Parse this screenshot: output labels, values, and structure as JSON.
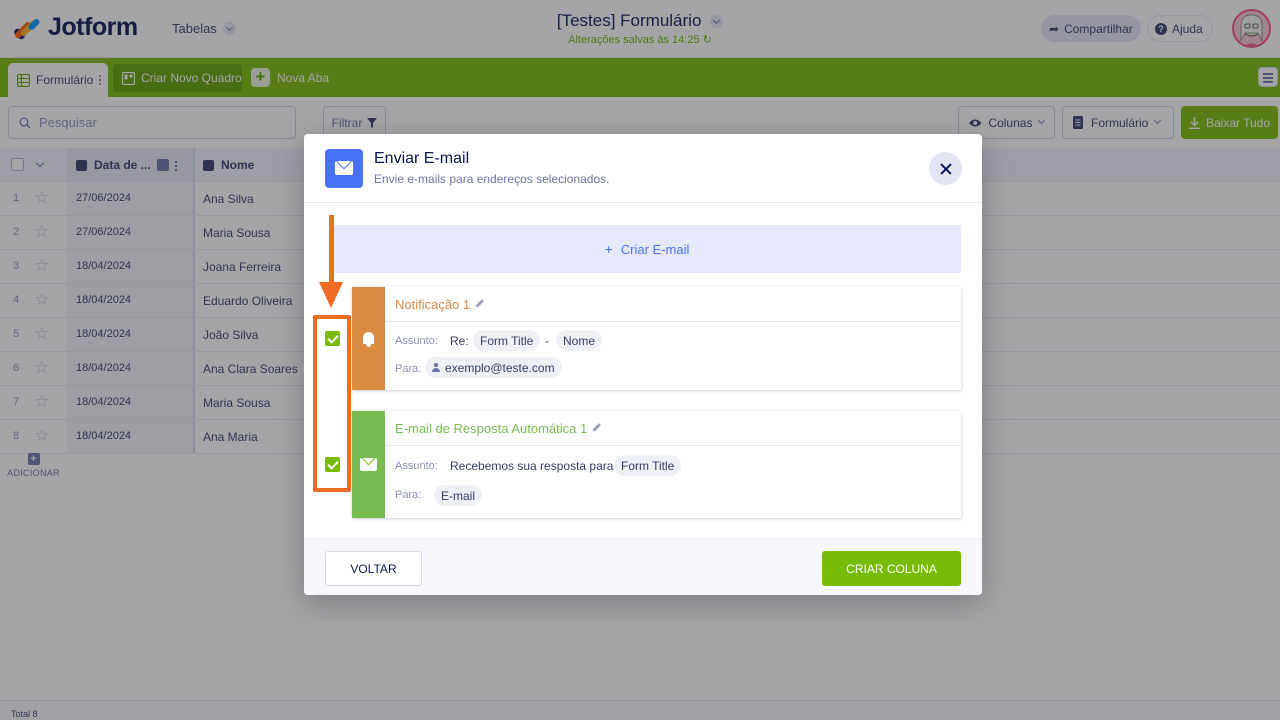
{
  "header": {
    "logo_text": "Jotform",
    "tables_menu": "Tabelas",
    "doc_title": "[Testes] Formulário",
    "status": "Alterações salvas às 14:25",
    "share": "Compartilhar",
    "help": "Ajuda"
  },
  "tabs": {
    "active": "Formulário",
    "board": "Criar Novo Quadro",
    "new_tab": "Nova Aba"
  },
  "toolbar": {
    "search_placeholder": "Pesquisar",
    "filter": "Filtrar",
    "columns": "Colunas",
    "form": "Formulário",
    "download": "Baixar Tudo"
  },
  "table": {
    "columns": [
      "Data de ...",
      "Nome"
    ],
    "rows": [
      {
        "num": "1",
        "date": "27/06/2024",
        "name": "Ana Silva"
      },
      {
        "num": "2",
        "date": "27/06/2024",
        "name": "Maria Sousa"
      },
      {
        "num": "3",
        "date": "18/04/2024",
        "name": "Joana Ferreira"
      },
      {
        "num": "4",
        "date": "18/04/2024",
        "name": "Eduardo Oliveira"
      },
      {
        "num": "5",
        "date": "18/04/2024",
        "name": "João Silva"
      },
      {
        "num": "6",
        "date": "18/04/2024",
        "name": "Ana Clara Soares"
      },
      {
        "num": "7",
        "date": "18/04/2024",
        "name": "Maria Sousa"
      },
      {
        "num": "8",
        "date": "18/04/2024",
        "name": "Ana Maria"
      }
    ],
    "add_label": "ADICIONAR",
    "total": "Total 8"
  },
  "modal": {
    "title": "Enviar E-mail",
    "subtitle": "Envie e-mails para endereços selecionados.",
    "create_email": "Criar E-mail",
    "cards": [
      {
        "title": "Notificação 1",
        "subject_label": "Assunto:",
        "subject_prefix": "Re:",
        "subject_chip_1": "Form Title",
        "subject_sep": "-",
        "subject_chip_2": "Nome",
        "to_label": "Para:",
        "to_chip": "exemplo@teste.com",
        "color": "#dc8c42",
        "checked": true
      },
      {
        "title": "E-mail de Resposta Automática 1",
        "subject_label": "Assunto:",
        "subject_text": "Recebemos sua resposta para",
        "subject_chip_1": "Form Title",
        "to_label": "Para:",
        "to_chip": "E-mail",
        "color": "#78bb52",
        "checked": true
      }
    ],
    "back": "VOLTAR",
    "create_column": "CRIAR COLUNA"
  },
  "colors": {
    "brand_green": "#78bb07",
    "accent_blue": "#4973f6",
    "annotation_orange": "#f06b23"
  }
}
